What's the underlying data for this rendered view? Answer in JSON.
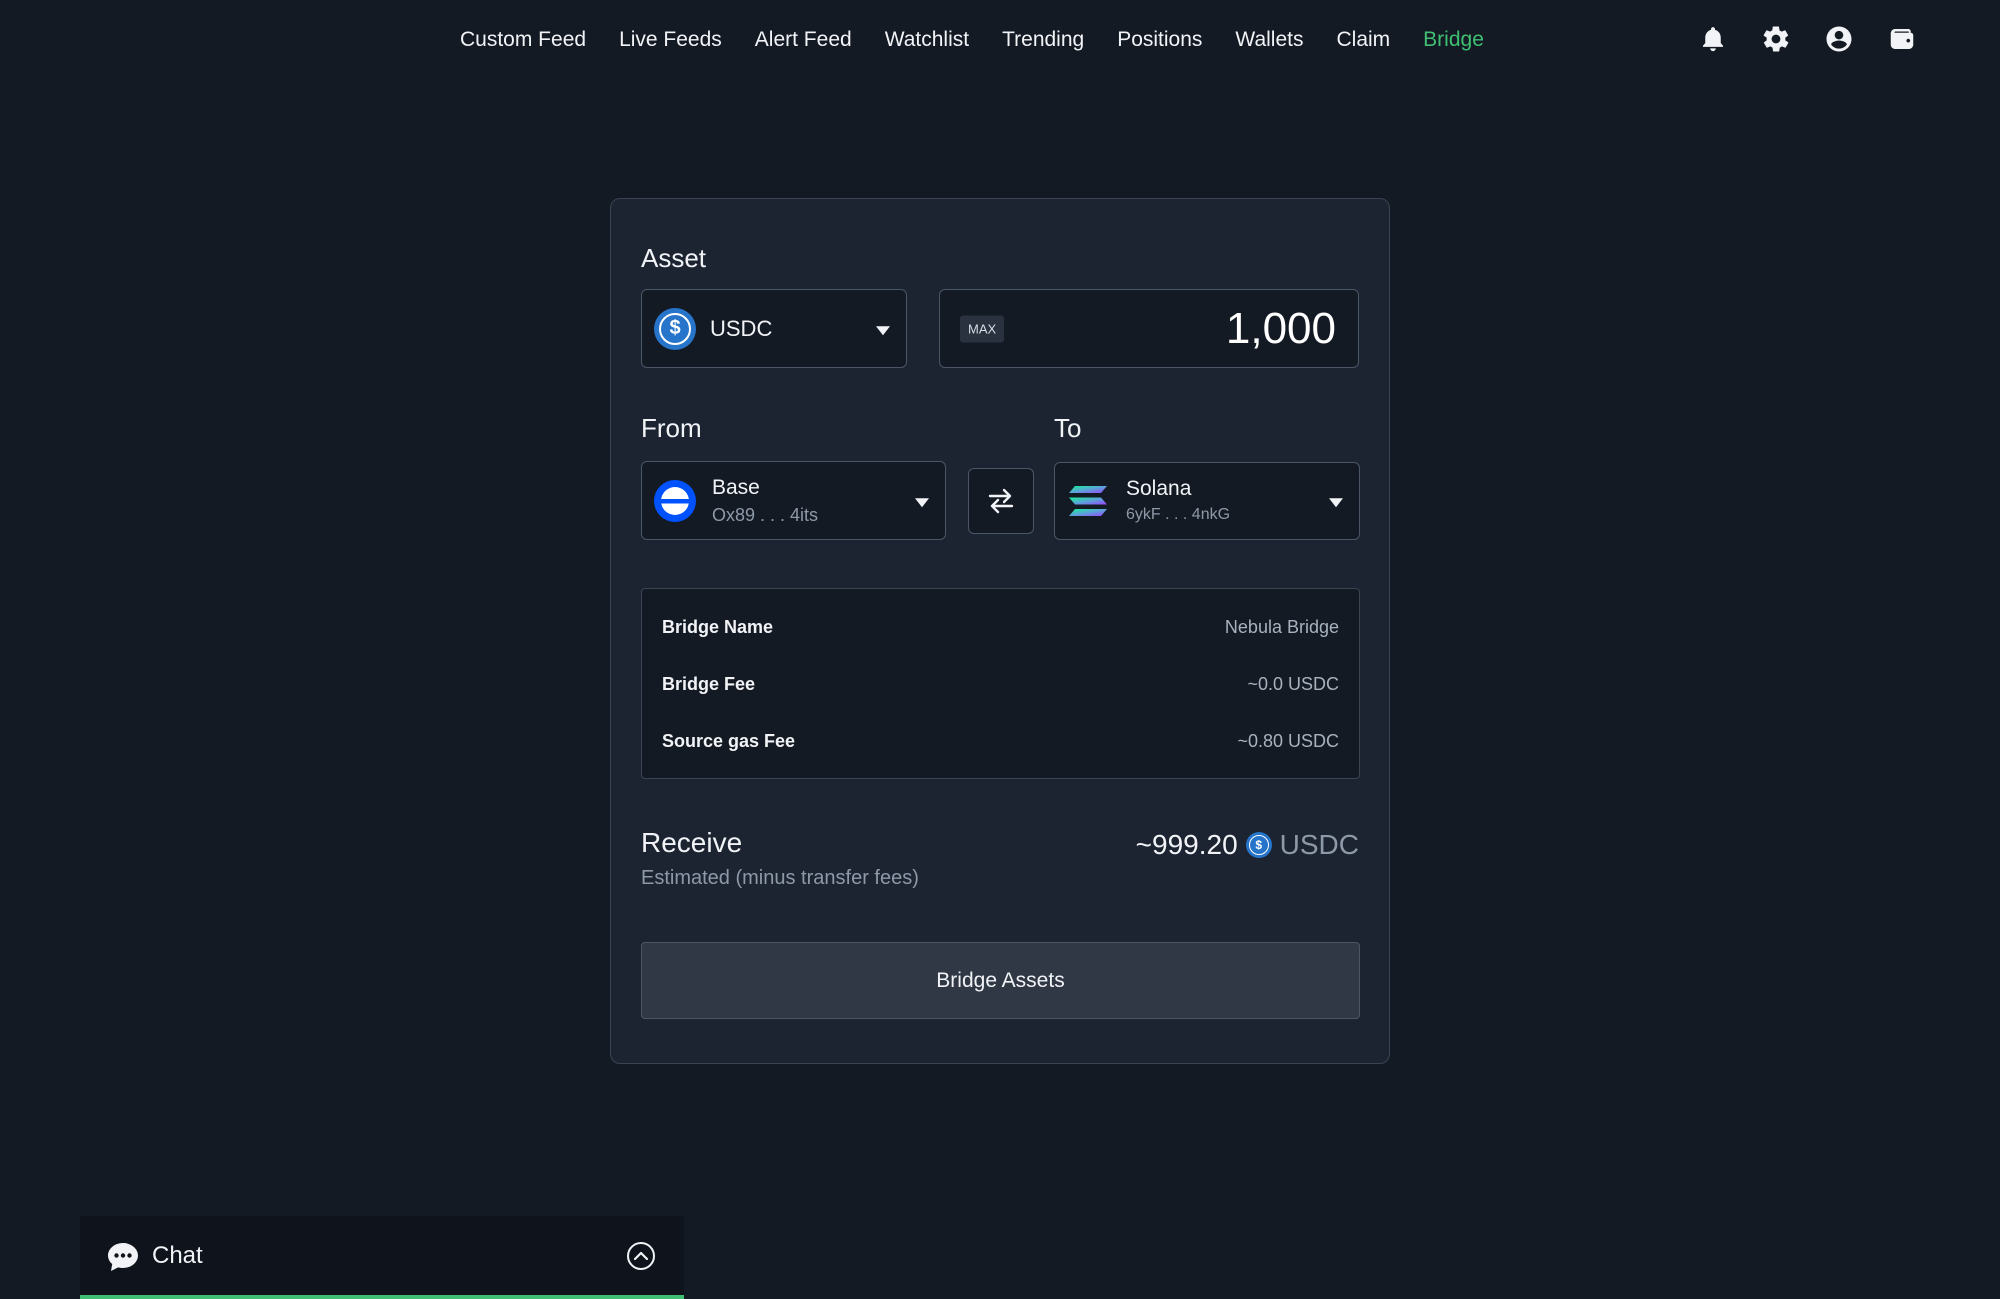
{
  "nav": {
    "links": [
      {
        "label": "Custom Feed"
      },
      {
        "label": "Live Feeds"
      },
      {
        "label": "Alert Feed"
      },
      {
        "label": "Watchlist"
      },
      {
        "label": "Trending"
      },
      {
        "label": "Positions"
      },
      {
        "label": "Wallets"
      },
      {
        "label": "Claim"
      },
      {
        "label": "Bridge",
        "active": true
      }
    ],
    "icons": [
      "bell-icon",
      "gear-icon",
      "user-circle-icon",
      "wallet-icon"
    ],
    "active_color": "#3fbf72"
  },
  "bridge": {
    "asset_label": "Asset",
    "asset": {
      "symbol": "USDC",
      "icon": "usdc-coin-icon",
      "color": "#2775ca"
    },
    "max_label": "MAX",
    "amount": "1,000",
    "from_label": "From",
    "to_label": "To",
    "from": {
      "chain": "Base",
      "address": "Ox89 . . . 4its",
      "icon": "base-chain-icon",
      "color": "#0052ff"
    },
    "to": {
      "chain": "Solana",
      "address": "6ykF . . . 4nkG",
      "icon": "solana-chain-icon"
    },
    "details": [
      {
        "key": "Bridge Name",
        "value": "Nebula Bridge"
      },
      {
        "key": "Bridge Fee",
        "value": "~0.0 USDC"
      },
      {
        "key": "Source gas Fee",
        "value": "~0.80 USDC"
      }
    ],
    "receive_label": "Receive",
    "receive_sub": "Estimated (minus transfer fees)",
    "receive_value": "~999.20",
    "receive_unit": "USDC",
    "button_label": "Bridge Assets"
  },
  "chat": {
    "label": "Chat",
    "accent": "#3fbf72"
  }
}
